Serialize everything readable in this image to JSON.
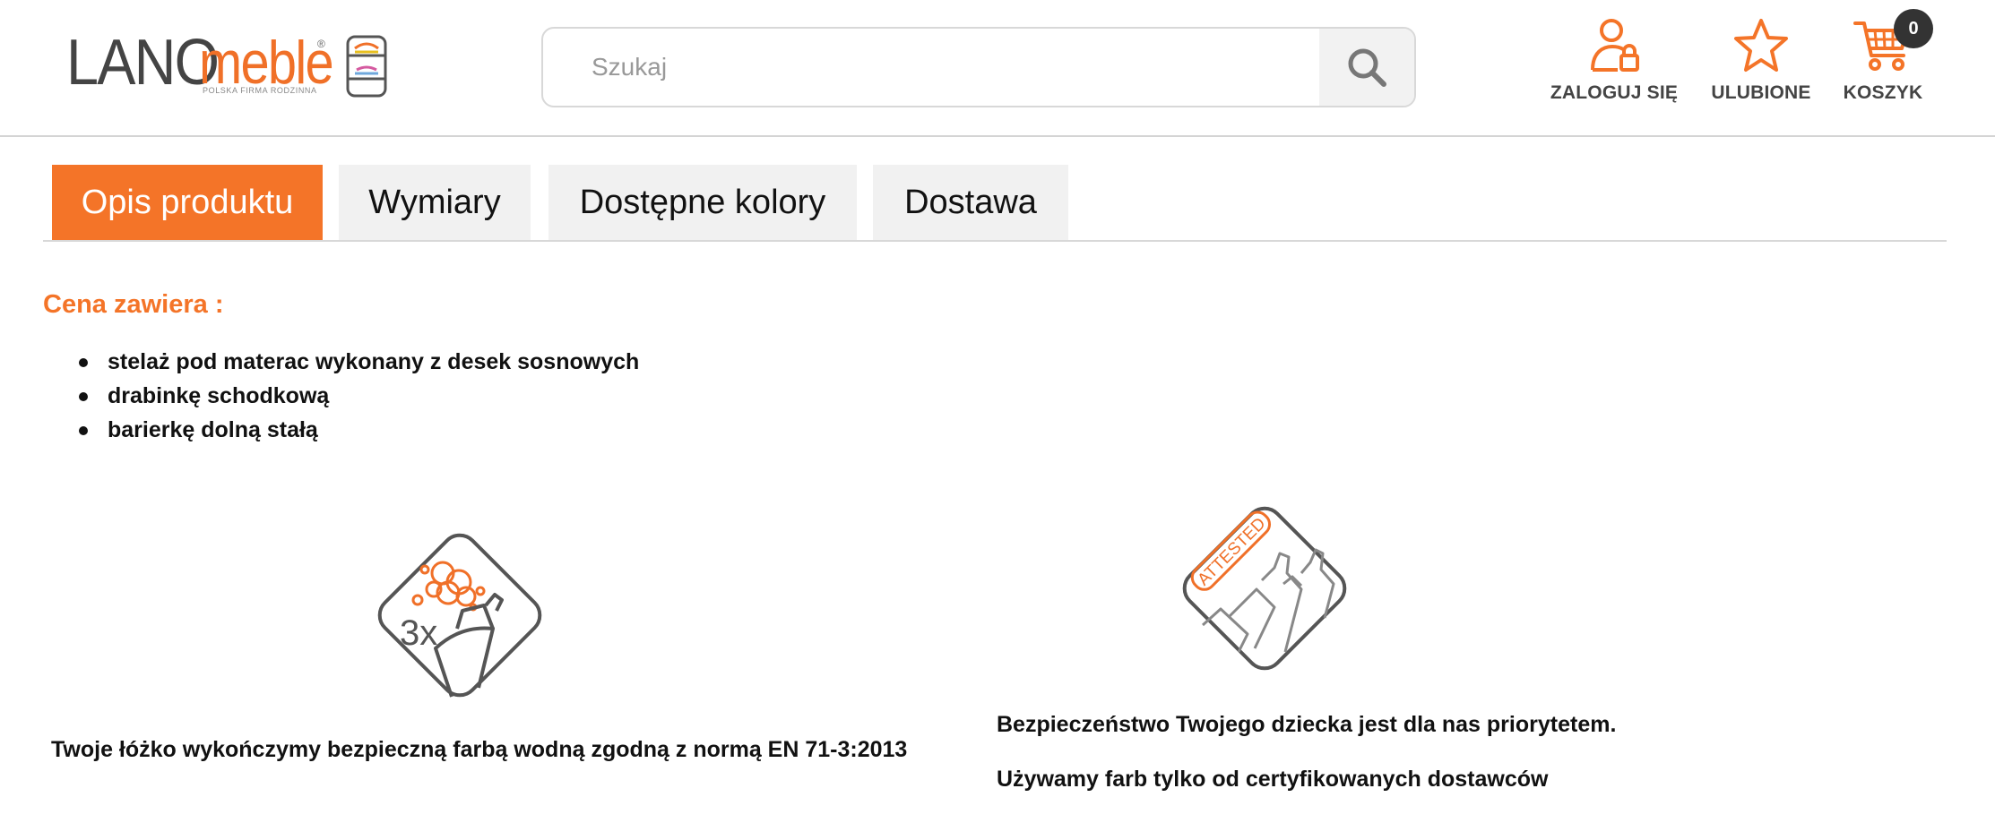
{
  "header": {
    "logo": {
      "brand_main": "LANO",
      "brand_accent": "meble",
      "registered": "®",
      "tagline": "POLSKA FIRMA RODZINNA"
    },
    "search": {
      "placeholder": "Szukaj",
      "value": "",
      "button_icon": "search-icon"
    },
    "links": {
      "login": {
        "label": "ZALOGUJ SIĘ",
        "icon": "user-lock-icon"
      },
      "favorites": {
        "label": "ULUBIONE",
        "icon": "star-icon"
      },
      "cart": {
        "label": "KOSZYK",
        "icon": "cart-icon",
        "count": "0"
      }
    }
  },
  "tabs": [
    {
      "label": "Opis produktu",
      "active": true
    },
    {
      "label": "Wymiary",
      "active": false
    },
    {
      "label": "Dostępne kolory",
      "active": false
    },
    {
      "label": "Dostawa",
      "active": false
    }
  ],
  "content": {
    "price_title": "Cena zawiera :",
    "price_items": [
      "stelaż pod materac wykonany z desek sosnowych",
      "drabinkę schodkową",
      "barierkę dolną stałą"
    ],
    "features": [
      {
        "icon": "spray-paint-3x-icon",
        "icon_text": "3x",
        "lines": [
          "Twoje łóżko wykończymy bezpieczną farbą wodną zgodną z normą EN 71-3:2013"
        ]
      },
      {
        "icon": "attested-paint-icon",
        "icon_text": "ATTESTED",
        "lines": [
          "Bezpieczeństwo Twojego dziecka jest dla nas priorytetem.",
          "Używamy farb tylko od certyfikowanych dostawców"
        ]
      }
    ]
  },
  "colors": {
    "accent": "#f47428",
    "text": "#111111",
    "muted": "#444444",
    "tab_bg": "#f1f1f1",
    "badge": "#333333"
  }
}
